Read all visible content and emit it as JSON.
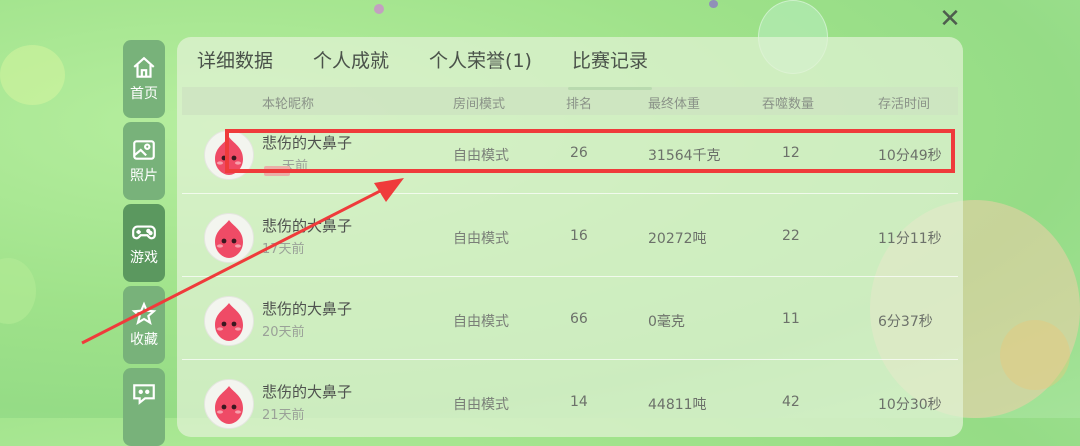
{
  "close_icon": "close-x-icon",
  "sidebar": [
    {
      "label": "首页",
      "icon": "home-icon",
      "active": false
    },
    {
      "label": "照片",
      "icon": "photo-icon",
      "active": false
    },
    {
      "label": "游戏",
      "icon": "gamepad-icon",
      "active": true
    },
    {
      "label": "收藏",
      "icon": "star-icon",
      "active": false
    },
    {
      "label": "",
      "icon": "chat-icon",
      "active": false
    }
  ],
  "tabs": [
    "详细数据",
    "个人成就",
    "个人荣誉(1)",
    "比赛记录"
  ],
  "active_tab": "比赛记录",
  "headers": {
    "nick": "本轮昵称",
    "mode": "房间模式",
    "rank": "排名",
    "weight": "最终体重",
    "eat": "吞噬数量",
    "time": "存活时间"
  },
  "rows": [
    {
      "nick": "悲伤的大鼻子",
      "ago": "天前",
      "mode": "自由模式",
      "rank": "26",
      "weight": "31564千克",
      "eat": "12",
      "time": "10分49秒"
    },
    {
      "nick": "悲伤的大鼻子",
      "ago": "17天前",
      "mode": "自由模式",
      "rank": "16",
      "weight": "20272吨",
      "eat": "22",
      "time": "11分11秒"
    },
    {
      "nick": "悲伤的大鼻子",
      "ago": "20天前",
      "mode": "自由模式",
      "rank": "66",
      "weight": "0毫克",
      "eat": "11",
      "time": "6分37秒"
    },
    {
      "nick": "悲伤的大鼻子",
      "ago": "21天前",
      "mode": "自由模式",
      "rank": "14",
      "weight": "44811吨",
      "eat": "42",
      "time": "10分30秒"
    }
  ],
  "colors": {
    "highlight": "#ef3b3b",
    "accent": "#6bb26b",
    "sidebar": "#78b27a"
  }
}
